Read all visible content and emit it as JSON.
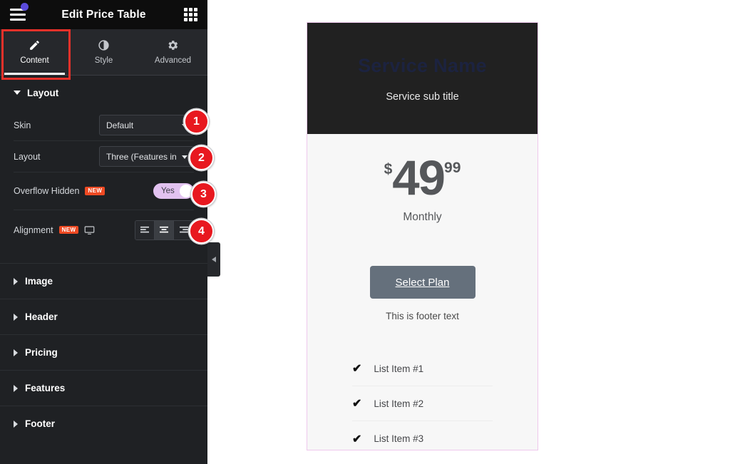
{
  "panel": {
    "title": "Edit Price Table",
    "menu_icon": "hamburger-icon",
    "apps_icon": "apps-grid-icon",
    "collapse_icon": "chevron-left-icon",
    "tabs": [
      {
        "label": "Content",
        "icon": "pencil-icon",
        "active": true
      },
      {
        "label": "Style",
        "icon": "contrast-circle-icon",
        "active": false
      },
      {
        "label": "Advanced",
        "icon": "gear-icon",
        "active": false
      }
    ],
    "layout_section": {
      "title": "Layout",
      "controls": {
        "skin": {
          "label": "Skin",
          "value": "Default"
        },
        "layout": {
          "label": "Layout",
          "value": "Three (Features in"
        },
        "overflow_hidden": {
          "label": "Overflow Hidden",
          "badge": "NEW",
          "toggle_value": "Yes"
        },
        "alignment": {
          "label": "Alignment",
          "badge": "NEW",
          "device_icon": "monitor-icon",
          "options": [
            "left",
            "center",
            "right"
          ],
          "selected": "center"
        }
      }
    },
    "sections": [
      {
        "label": "Image"
      },
      {
        "label": "Header"
      },
      {
        "label": "Pricing"
      },
      {
        "label": "Features"
      },
      {
        "label": "Footer"
      }
    ]
  },
  "annotations": [
    {
      "number": "1"
    },
    {
      "number": "2"
    },
    {
      "number": "3"
    },
    {
      "number": "4"
    }
  ],
  "preview": {
    "heading": "Service Name",
    "sub_heading": "Service sub title",
    "price": {
      "currency": "$",
      "integer": "49",
      "fraction": "99",
      "period": "Monthly"
    },
    "button_label": "Select Plan",
    "footer_text": "This is footer text",
    "features": [
      {
        "label": "List Item #1",
        "icon": "check-icon"
      },
      {
        "label": "List Item #2",
        "icon": "check-icon"
      },
      {
        "label": "List Item #3",
        "icon": "check-icon"
      }
    ]
  },
  "colors": {
    "panel_bg": "#1f2124",
    "accent_red": "#e8181f",
    "new_badge": "#ef4a23",
    "toggle_on": "#e2c2f0",
    "card_border": "#eec8ec"
  }
}
